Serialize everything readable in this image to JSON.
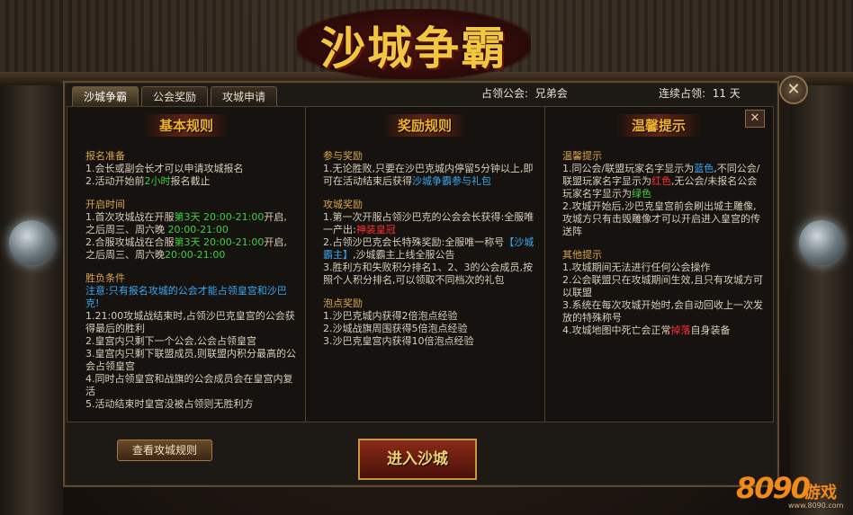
{
  "title": "沙城争霸",
  "tabs": [
    "沙城争霸",
    "公会奖励",
    "攻城申请"
  ],
  "occupy_guild_label": "占领公会:",
  "occupy_guild_value": "兄弟会",
  "occupy_days_label": "连续占领:",
  "occupy_days_value": "11 天",
  "columns": {
    "basic": {
      "heading": "基本规则",
      "s1_title": "报名准备",
      "s1_l1": "1.会长或副会长才可以申请攻城报名",
      "s1_l2a": "2.活动开始前",
      "s1_l2b": "2小时",
      "s1_l2c": "报名截止",
      "s2_title": "开启时间",
      "s2_l1a": "1.首次攻城战在开服",
      "s2_l1b": "第3天 20:00-21:00",
      "s2_l1c": "开启,之后周三、周六晚",
      "s2_l1d": "20:00-21:00",
      "s2_l2a": "2.合服攻城战在合服",
      "s2_l2b": "第3天 20:00-21:00",
      "s2_l2c": "开启,之后周三、周六晚",
      "s2_l2d": "20:00-21:00",
      "s3_title": "胜负条件",
      "s3_note": "注意:只有报名攻城的公会才能占领皇宫和沙巴克!",
      "s3_l1": "1.21:00攻城战结束时,占领沙巴克皇宫的公会获得最后的胜利",
      "s3_l2": "2.皇宫内只剩下一个公会,公会占领皇宫",
      "s3_l3": "3.皇宫内只剩下联盟成员,则联盟内积分最高的公会占领皇宫",
      "s3_l4": "4.同时占领皇宫和战旗的公会成员会在皇宫内复活",
      "s3_l5": "5.活动结束时皇宫没被占领则无胜利方"
    },
    "reward": {
      "heading": "奖励规则",
      "s1_title": "参与奖励",
      "s1_l1a": "1.无论胜败,只要在沙巴克城内停留5分钟以上,即可在活动结束后获得",
      "s1_l1b": "沙城争霸参与礼包",
      "s2_title": "攻城奖励",
      "s2_l1a": "1.第一次开服占领沙巴克的公会会长获得:全服唯一产出:",
      "s2_l1b": "神装皇冠",
      "s2_l2a": "2.占领沙巴克会长特殊奖励:全服唯一称号",
      "s2_l2b": "【沙城霸主】",
      "s2_l2c": ",沙城霸主上线全服公告",
      "s2_l3": "3.胜利方和失败积分排名1、2、3的公会成员,按照个人积分排名,可以领取不同档次的礼包",
      "s3_title": "泡点奖励",
      "s3_l1": "1.沙巴克城内获得2倍泡点经验",
      "s3_l2": "2.沙城战旗周围获得5倍泡点经验",
      "s3_l3": "3.沙巴克皇宫内获得10倍泡点经验"
    },
    "tips": {
      "heading": "温馨提示",
      "s1_title": "温馨提示",
      "s1_l1a": "1.同公会/联盟玩家名字显示为",
      "s1_l1b": "蓝色",
      "s1_l1c": ",不同公会/联盟玩家名字显示为",
      "s1_l1d": "红色",
      "s1_l1e": ",无公会/未报名公会玩家名字显示为",
      "s1_l1f": "绿色",
      "s1_l2": "2.攻城开始后,沙巴克皇宫前会刷出城主雕像,攻城方只有击毁雕像才可以开启进入皇宫的传送阵",
      "s2_title": "其他提示",
      "s2_l1": "1.攻城期间无法进行任何公会操作",
      "s2_l2": "2.公会联盟只在攻城期间生效,且只有攻城方可以联盟",
      "s2_l3": "3.系统在每次攻城开始时,会自动回收上一次发放的特殊称号",
      "s2_l4a": "4.攻城地图中死亡会正常",
      "s2_l4b": "掉落",
      "s2_l4c": "自身装备"
    }
  },
  "buttons": {
    "view_rules": "查看攻城规则",
    "enter": "进入沙城"
  },
  "logo": {
    "num": "8090",
    "cn": "游戏",
    "url": "www.8090.com"
  },
  "colors": {
    "accent_gold": "#f0b030",
    "highlight_green": "#3fd03f",
    "highlight_blue": "#3aa8f0",
    "highlight_red": "#ff3030"
  }
}
